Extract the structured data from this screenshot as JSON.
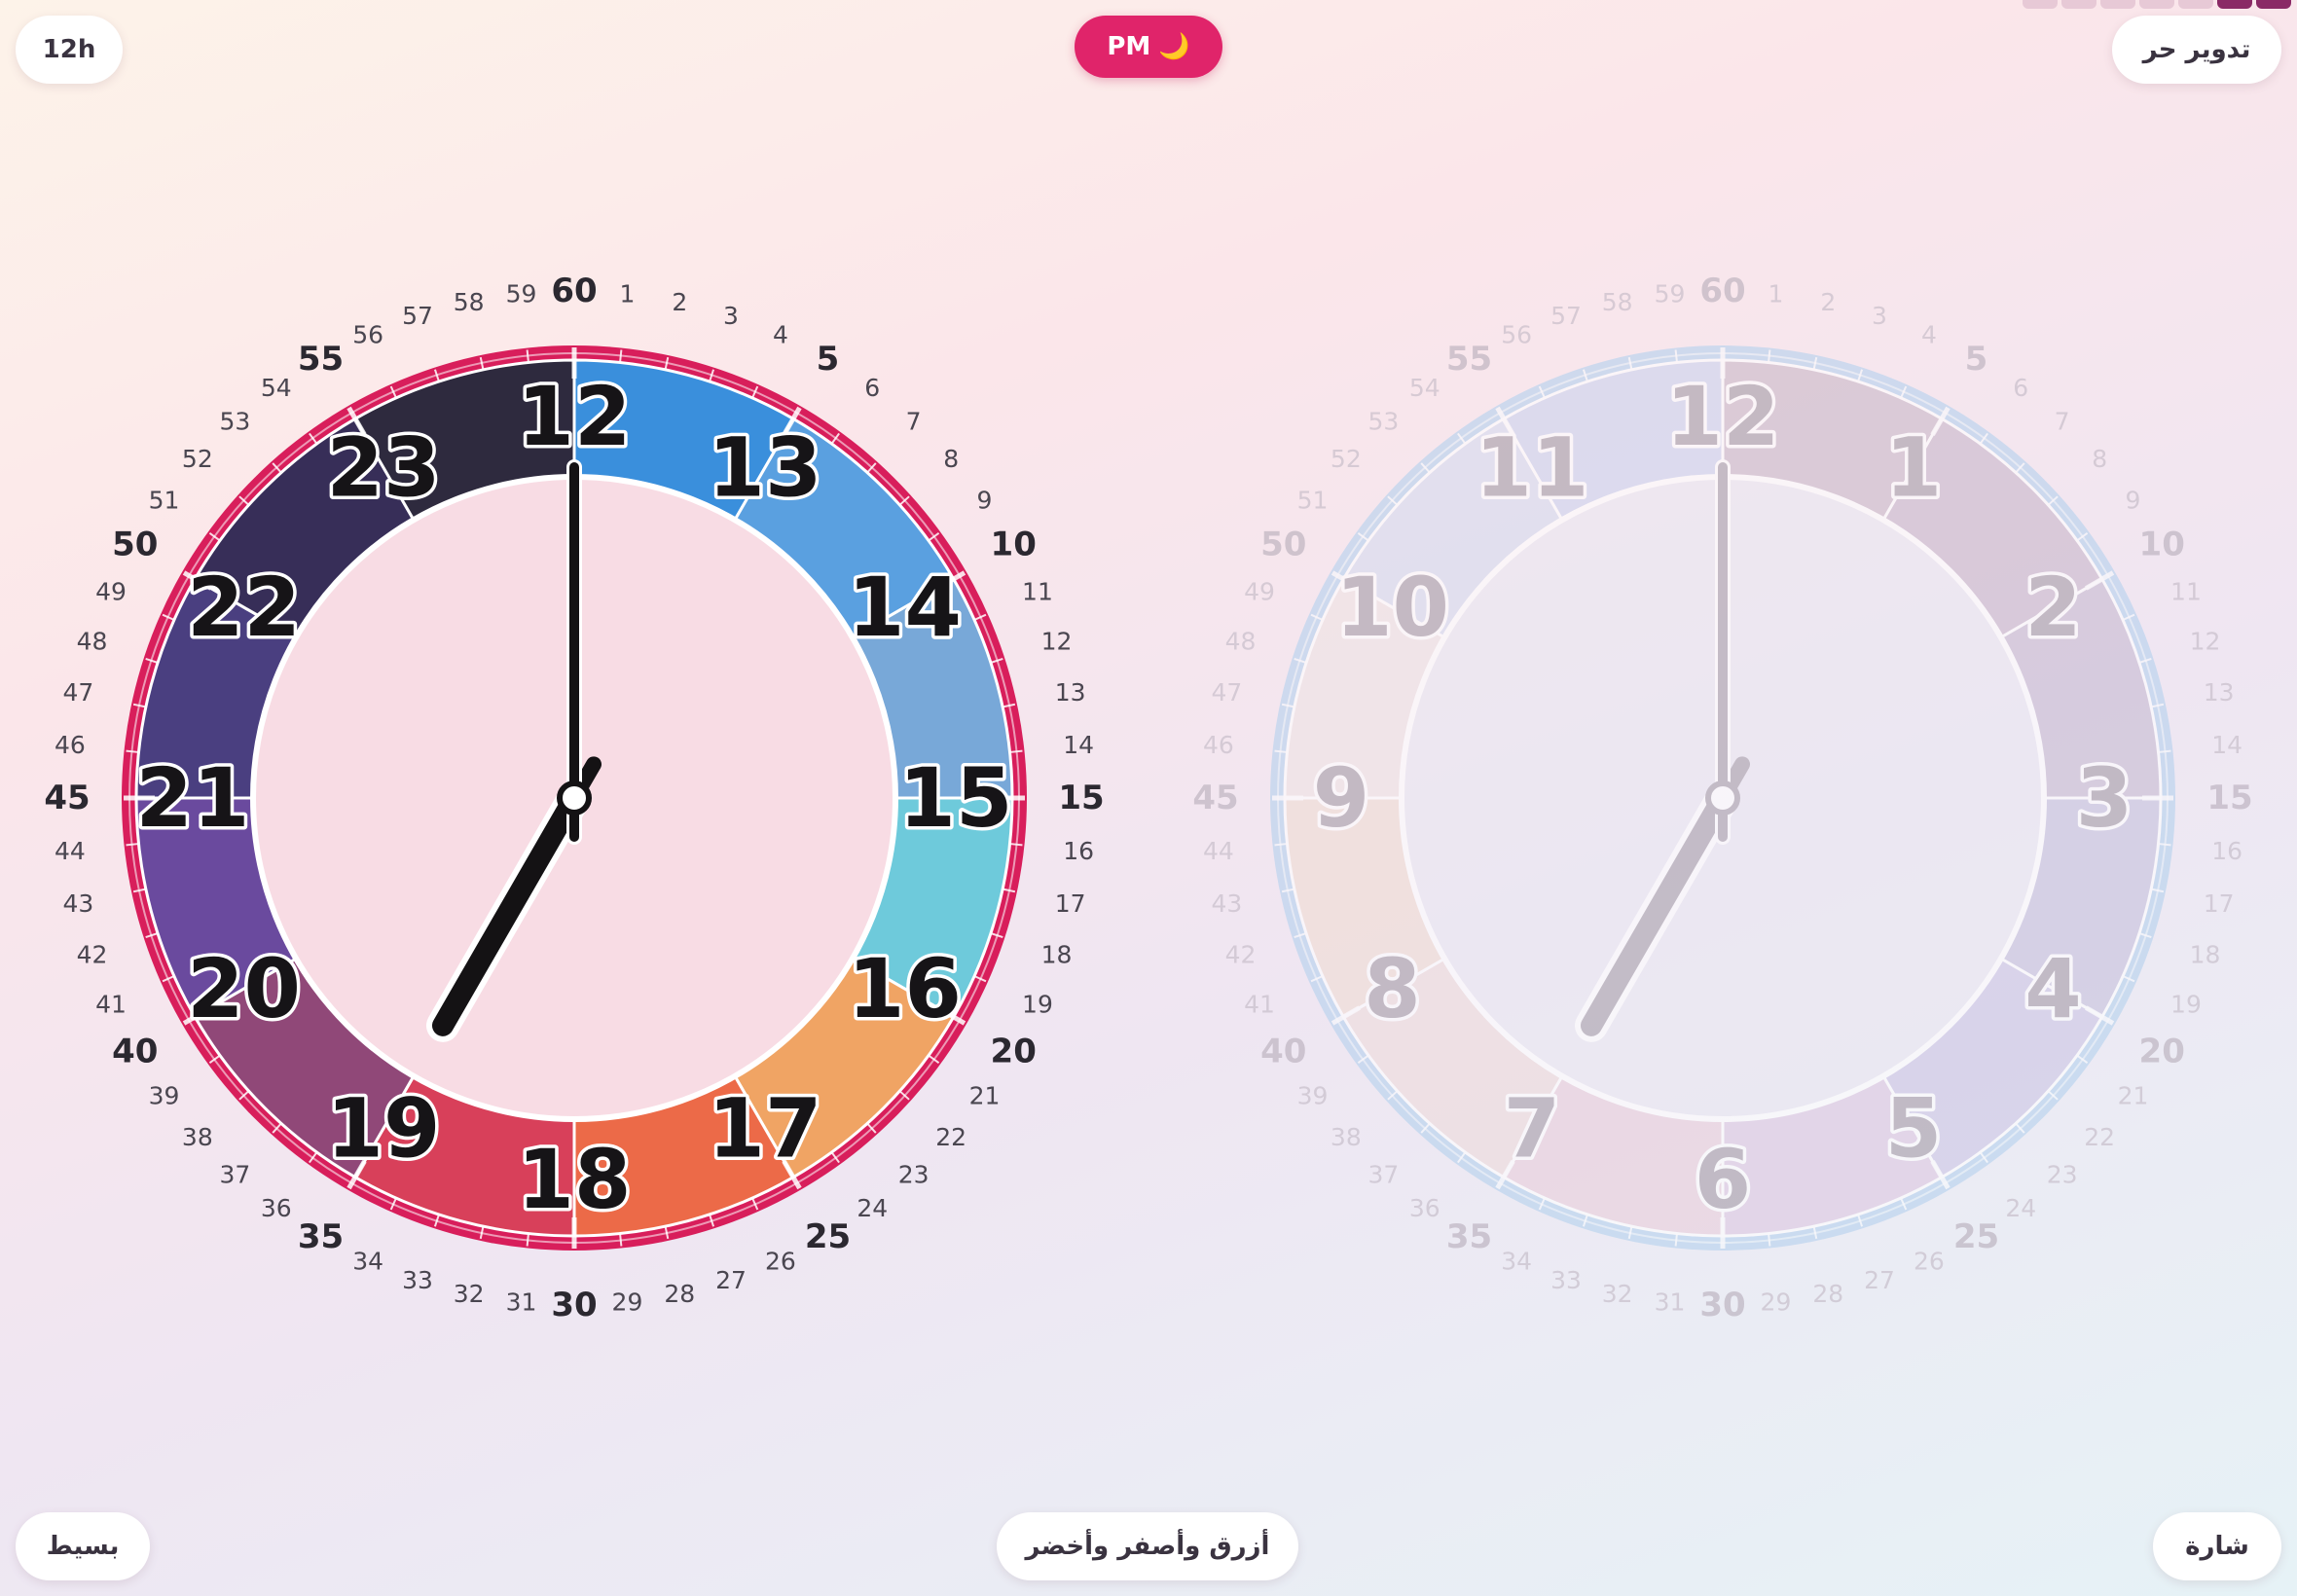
{
  "toolbar": {
    "hour_mode_label": "12h",
    "ampm_label": "PM",
    "ampm_icon": "moon-icon",
    "rotate_label": "تدوير حر",
    "style_label": "بسيط",
    "theme_label": "أزرق وأصفر وأخضر",
    "badge_label": "شارة"
  },
  "progress": {
    "total_steps": 7,
    "current_step": 7
  },
  "time": {
    "hour24": 19,
    "minute": 0,
    "period": "PM"
  },
  "minute_labels": [
    "60",
    "1",
    "2",
    "3",
    "4",
    "5",
    "6",
    "7",
    "8",
    "9",
    "10",
    "11",
    "12",
    "13",
    "14",
    "15",
    "16",
    "17",
    "18",
    "19",
    "20",
    "21",
    "22",
    "23",
    "24",
    "25",
    "26",
    "27",
    "28",
    "29",
    "30",
    "31",
    "32",
    "33",
    "34",
    "35",
    "36",
    "37",
    "38",
    "39",
    "40",
    "41",
    "42",
    "43",
    "44",
    "45",
    "46",
    "47",
    "48",
    "49",
    "50",
    "51",
    "52",
    "53",
    "54",
    "55",
    "56",
    "57",
    "58",
    "59"
  ],
  "left_clock": {
    "hour_labels": [
      "12",
      "13",
      "14",
      "15",
      "16",
      "17",
      "18",
      "19",
      "20",
      "21",
      "22",
      "23"
    ],
    "segment_colors": [
      "#3a8fdc",
      "#5aa0e0",
      "#78a8d8",
      "#6ecadb",
      "#f0a464",
      "#ec6a48",
      "#d8405a",
      "#904878",
      "#6a4a9e",
      "#4a3f80",
      "#372e58",
      "#2e2a3e"
    ],
    "ring_color": "#d81e5b",
    "face_color": "#f8dce4"
  },
  "right_clock": {
    "hour_labels": [
      "12",
      "1",
      "2",
      "3",
      "4",
      "5",
      "6",
      "7",
      "8",
      "9",
      "10",
      "11"
    ],
    "segment_colors": [
      "#cbb9c9",
      "#cab8cc",
      "#c8bcd2",
      "#c7c2de",
      "#cdc6e6",
      "#ddc9e2",
      "#e9cfdc",
      "#eedcdc",
      "#f0ddd4",
      "#efe4e4",
      "#d6dcef",
      "#cdd4ee"
    ],
    "ring_color": "#b6d2ee",
    "face_color": "#eae8f2"
  }
}
